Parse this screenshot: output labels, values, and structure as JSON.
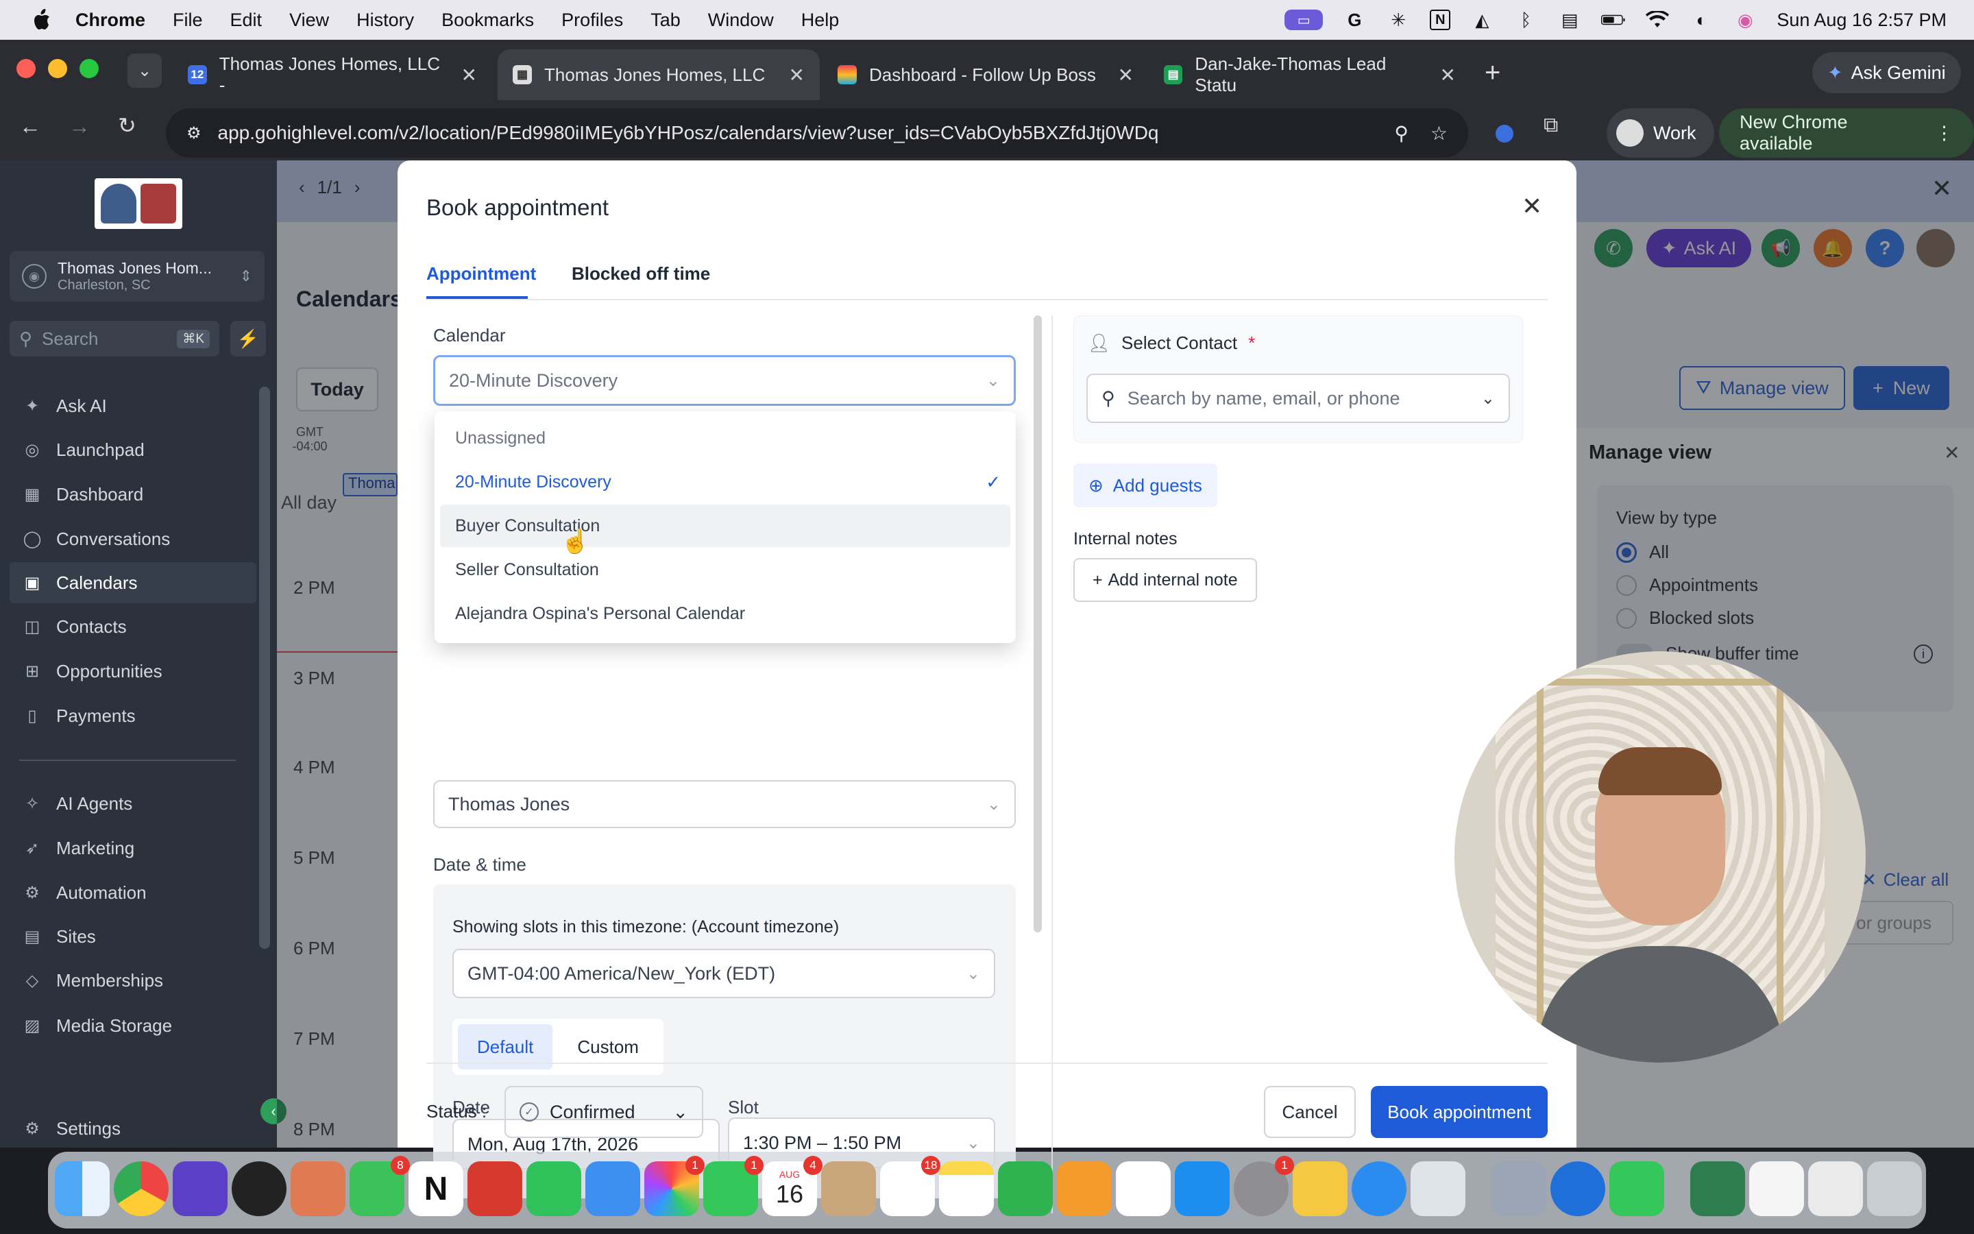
{
  "menubar": {
    "app_name": "Chrome",
    "items": [
      "File",
      "Edit",
      "View",
      "History",
      "Bookmarks",
      "Profiles",
      "Tab",
      "Window",
      "Help"
    ],
    "clock": "Sun Aug 16  2:57 PM"
  },
  "browser": {
    "tabs": [
      {
        "title": "Thomas Jones Homes, LLC -",
        "favicon_text": "12"
      },
      {
        "title": "Thomas Jones Homes, LLC",
        "favicon_text": ""
      },
      {
        "title": "Dashboard - Follow Up Boss",
        "favicon_text": ""
      },
      {
        "title": "Dan-Jake-Thomas Lead Statu",
        "favicon_text": ""
      }
    ],
    "ask_gemini": "Ask Gemini",
    "url": "app.gohighlevel.com/v2/location/PEd9980iIMEy6bYHPosz/calendars/view?user_ids=CVabOyb5BXZfdJtj0WDq",
    "profile": "Work",
    "update_notice": "New Chrome available"
  },
  "sidebar": {
    "location_name": "Thomas Jones Hom...",
    "location_city": "Charleston, SC",
    "search_placeholder": "Search",
    "search_shortcut": "⌘K",
    "items": [
      {
        "label": "Ask AI",
        "icon": "sparkle-icon"
      },
      {
        "label": "Launchpad",
        "icon": "rocket-icon"
      },
      {
        "label": "Dashboard",
        "icon": "grid-icon"
      },
      {
        "label": "Conversations",
        "icon": "chat-icon"
      },
      {
        "label": "Calendars",
        "icon": "calendar-icon"
      },
      {
        "label": "Contacts",
        "icon": "contacts-icon"
      },
      {
        "label": "Opportunities",
        "icon": "opportunities-icon"
      },
      {
        "label": "Payments",
        "icon": "payments-icon"
      },
      {
        "label": "AI Agents",
        "icon": "ai-agents-icon"
      },
      {
        "label": "Marketing",
        "icon": "marketing-icon"
      },
      {
        "label": "Automation",
        "icon": "automation-icon"
      },
      {
        "label": "Sites",
        "icon": "sites-icon"
      },
      {
        "label": "Memberships",
        "icon": "memberships-icon"
      },
      {
        "label": "Media Storage",
        "icon": "media-icon"
      }
    ],
    "settings": "Settings"
  },
  "background": {
    "pager": "1/1",
    "page_title": "Calendars",
    "today_button": "Today",
    "timezone_col": "GMT\n-04:00",
    "all_day": "All day",
    "event_chip": "Thoma",
    "hours": [
      "2 PM",
      "3 PM",
      "4 PM",
      "5 PM",
      "6 PM",
      "7 PM",
      "8 PM"
    ],
    "ask_ai": "Ask AI",
    "manage_view_button": "Manage view",
    "new_button": "New",
    "manage_view": {
      "title": "Manage view",
      "view_by_type": "View by type",
      "options": [
        "All",
        "Appointments",
        "Blocked slots"
      ],
      "selected": "All",
      "buffer": "Show buffer time",
      "clear_all": "Clear all",
      "groups": "or groups"
    }
  },
  "modal": {
    "title": "Book appointment",
    "tabs": [
      "Appointment",
      "Blocked off time"
    ],
    "active_tab": "Appointment",
    "calendar_label": "Calendar",
    "calendar_value": "20-Minute Discovery",
    "dropdown_options": [
      {
        "label": "Unassigned",
        "state": "header"
      },
      {
        "label": "20-Minute Discovery",
        "state": "selected"
      },
      {
        "label": "Buyer Consultation",
        "state": "hovered"
      },
      {
        "label": "Seller Consultation",
        "state": "normal"
      },
      {
        "label": "Alejandra Ospina's Personal Calendar",
        "state": "normal"
      }
    ],
    "team_member_value": "Thomas Jones",
    "date_time_label": "Date & time",
    "timezone_text": "Showing slots in this timezone: (Account timezone)",
    "timezone_value": "GMT-04:00 America/New_York (EDT)",
    "slot_mode": [
      "Default",
      "Custom"
    ],
    "date_label": "Date",
    "date_value": "Mon, Aug 17th, 2026",
    "slot_label": "Slot",
    "slot_value": "1:30 PM – 1:50 PM",
    "select_contact": "Select Contact",
    "required_mark": "*",
    "contact_placeholder": "Search by name, email, or phone",
    "add_guests": "Add guests",
    "internal_notes": "Internal notes",
    "add_internal_note": "Add internal note",
    "status_label": "Status :",
    "status_value": "Confirmed",
    "cancel": "Cancel",
    "book": "Book appointment"
  },
  "dock": {
    "badges": {
      "messages": "8",
      "photos": "1",
      "facetime": "1",
      "calendar": "4",
      "reminders": "18",
      "settings": "1"
    },
    "calendar_day": "16",
    "calendar_month": "AUG"
  },
  "colors": {
    "accent": "#1f5bd8",
    "sidebar": "#2c323c",
    "chrome": "#2b2d33"
  }
}
